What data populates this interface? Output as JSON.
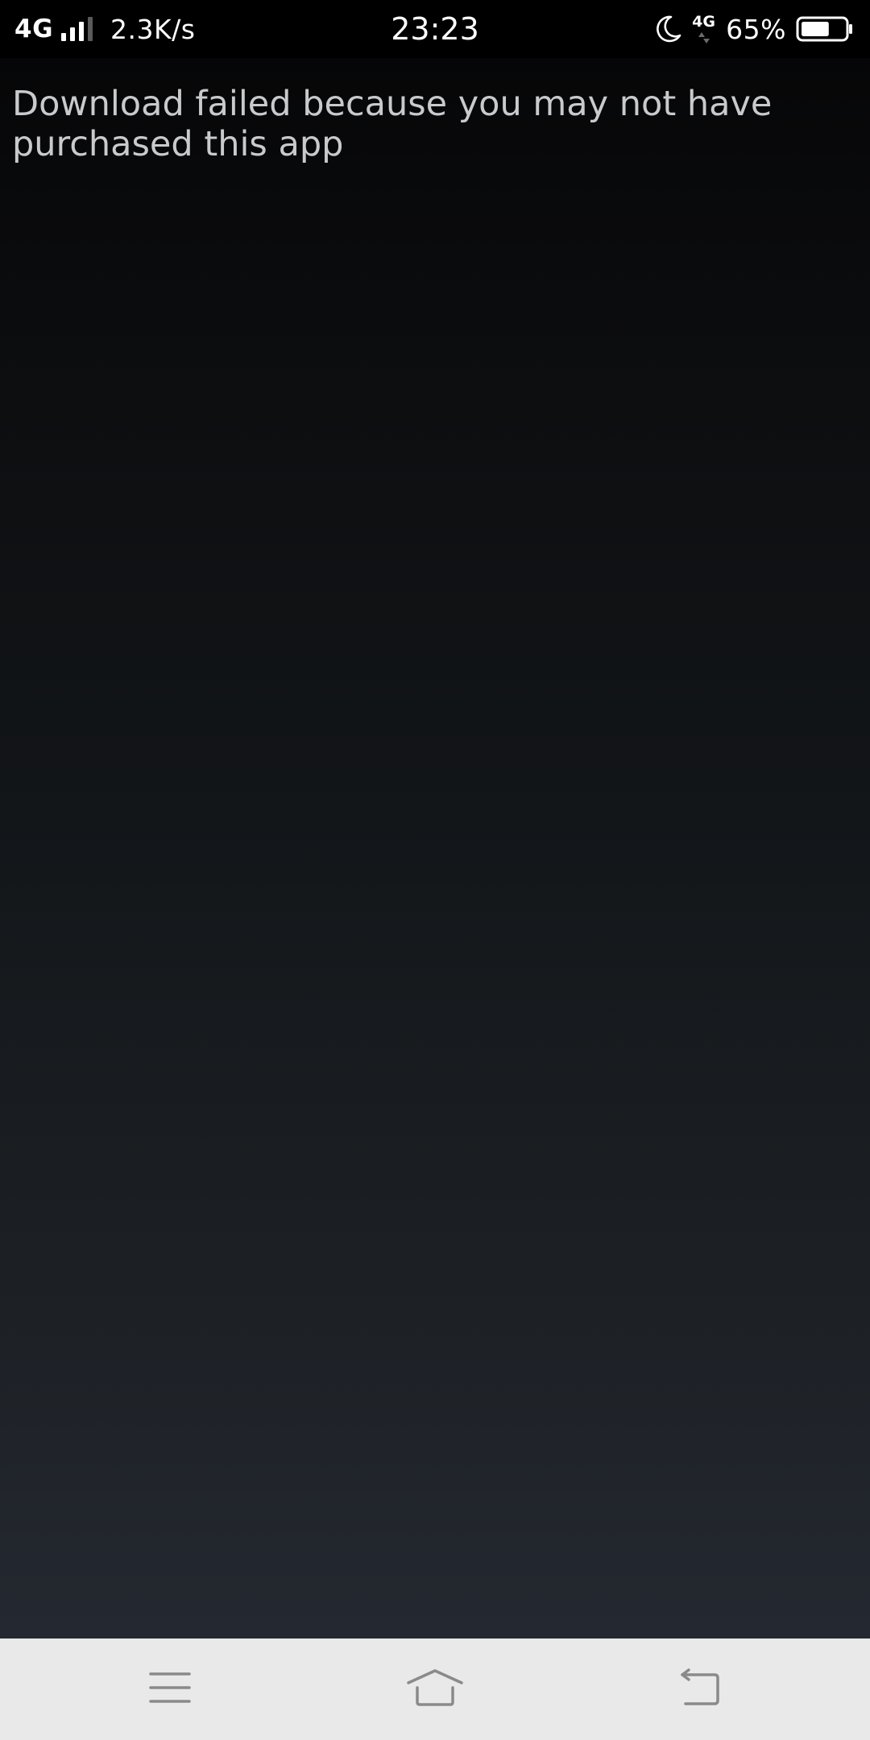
{
  "status_bar": {
    "network_type": "4G",
    "data_speed": "2.3K/s",
    "time": "23:23",
    "secondary_network": "4G",
    "battery_percent": "65%",
    "battery_level": 0.65,
    "icons": {
      "signal": "signal-strength-icon",
      "moon": "do-not-disturb-moon-icon",
      "data": "mobile-data-icon",
      "battery": "battery-icon"
    }
  },
  "content": {
    "message": "Download failed because you may not have purchased this app"
  },
  "nav_bar": {
    "icons": {
      "menu": "menu-icon",
      "home": "home-icon",
      "back": "back-icon"
    },
    "icon_color": "#8a8a8a"
  },
  "colors": {
    "status_bar_bg": "#000000",
    "message_text": "#c8cacc",
    "nav_bar_bg": "#e9e9e9"
  }
}
